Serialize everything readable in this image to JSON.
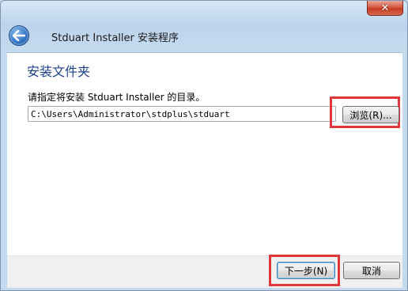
{
  "window": {
    "title": "Stduart Installer 安装程序",
    "close_label": "✕"
  },
  "page": {
    "heading": "安装文件夹",
    "prompt": "请指定将安装 Stduart Installer 的目录。",
    "path_value": "C:\\Users\\Administrator\\stdplus\\stduart",
    "browse_label": "浏览(R)..."
  },
  "footer": {
    "next_label": "下一步(N)",
    "cancel_label": "取消"
  },
  "colors": {
    "heading": "#1b3f8b",
    "highlight": "#e0363a",
    "close_button": "#c43a22"
  },
  "icons": {
    "back": "back-arrow-icon",
    "close": "close-icon"
  }
}
